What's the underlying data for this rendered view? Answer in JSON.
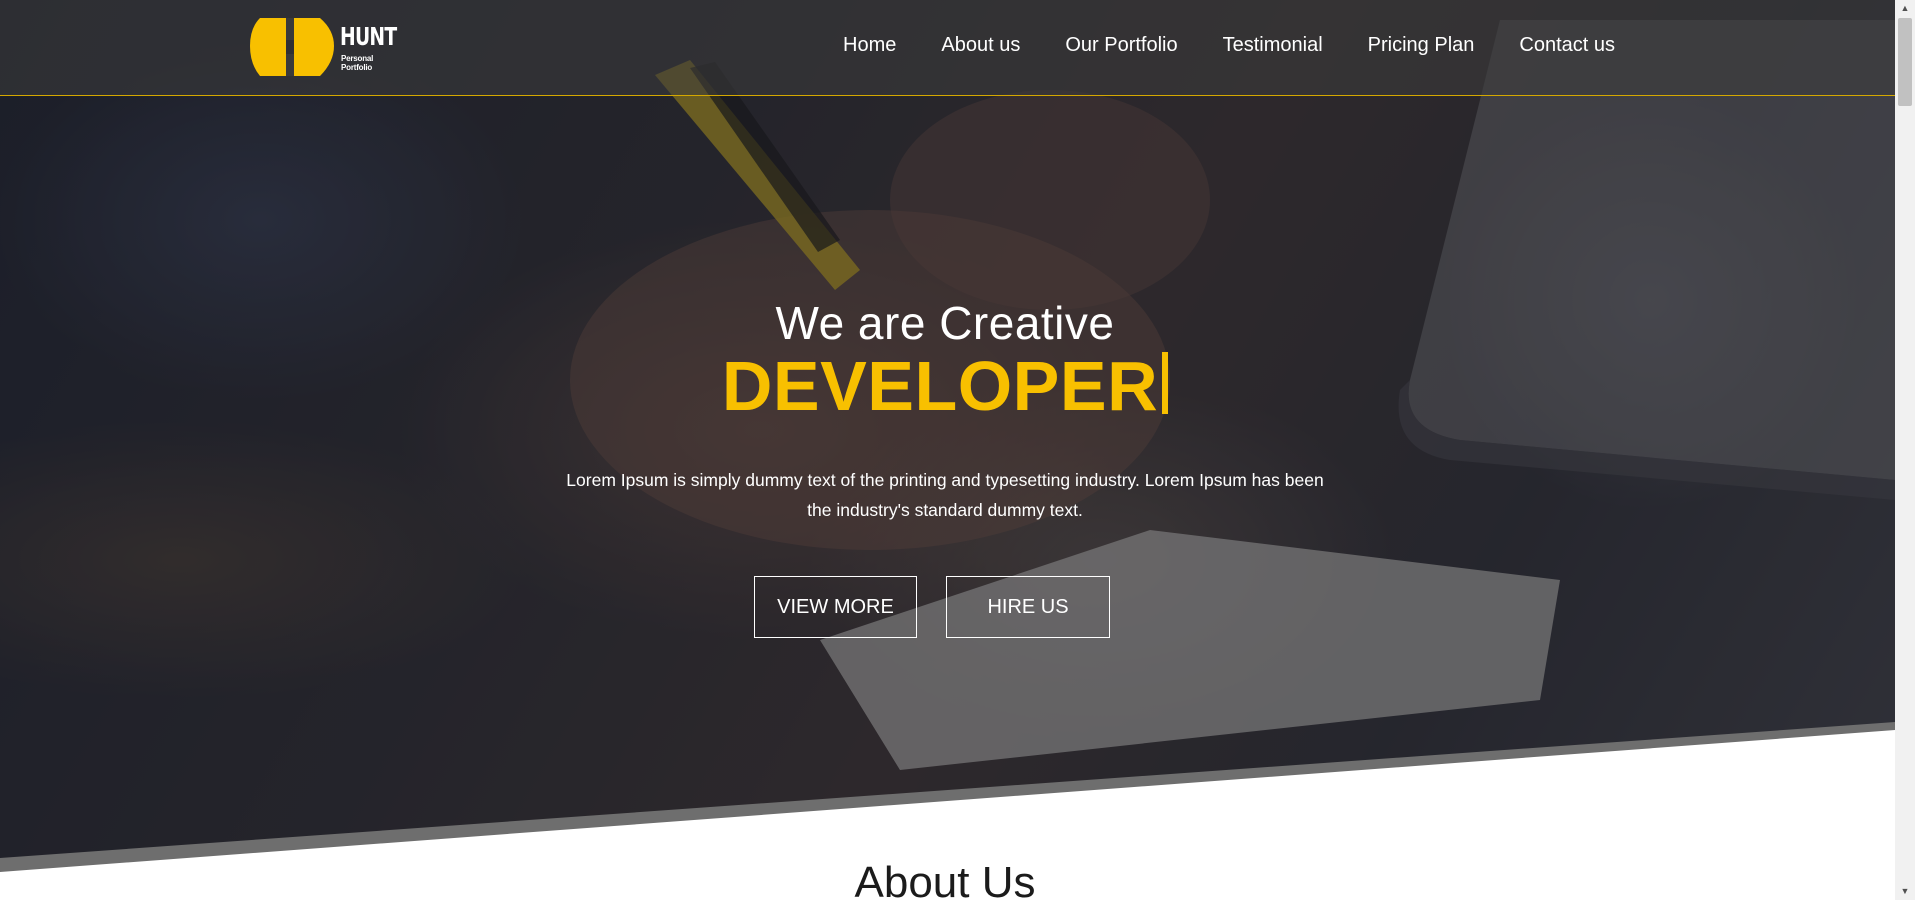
{
  "header": {
    "logo": {
      "wordmark": "HUNT",
      "tagline": "Personal Portfolio"
    },
    "nav": [
      {
        "label": "Home"
      },
      {
        "label": "About us"
      },
      {
        "label": "Our Portfolio"
      },
      {
        "label": "Testimonial"
      },
      {
        "label": "Pricing Plan"
      },
      {
        "label": "Contact us"
      }
    ]
  },
  "hero": {
    "kicker": "We are Creative",
    "title": "DEVELOPER",
    "description": "Lorem Ipsum is simply dummy text of the printing and typesetting industry. Lorem Ipsum has been the industry's standard dummy text.",
    "buttons": {
      "view_more": "VIEW MORE",
      "hire_us": "HIRE US"
    }
  },
  "about": {
    "heading": "About Us"
  },
  "colors": {
    "accent": "#f8c000",
    "header_border": "#d4a800",
    "text_light": "#ffffff",
    "heading_dark": "#1b1b1b"
  },
  "icons": {
    "logo": "hunt-h-logo-icon",
    "scroll_up": "chevron-up-icon",
    "scroll_down": "chevron-down-icon"
  }
}
